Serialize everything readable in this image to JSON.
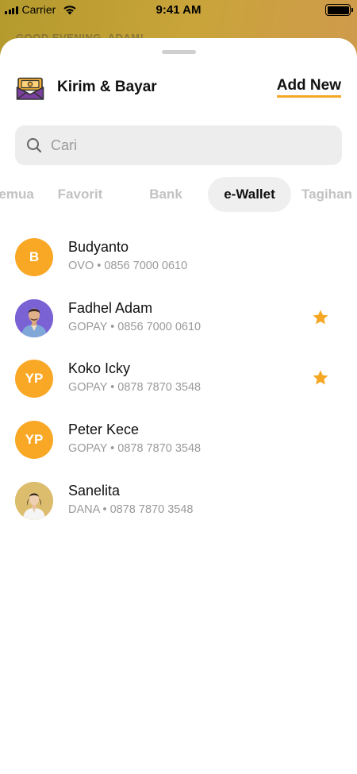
{
  "status_bar": {
    "carrier": "Carrier",
    "time": "9:41 AM"
  },
  "background": {
    "greeting": "GOOD EVENING, ADAM!"
  },
  "header": {
    "title": "Kirim & Bayar",
    "add_new_label": "Add New",
    "icon": "money-envelope-icon"
  },
  "search": {
    "placeholder": "Cari",
    "value": ""
  },
  "tabs": [
    {
      "label": "Semua",
      "active": false
    },
    {
      "label": "Favorit",
      "active": false
    },
    {
      "label": "Bank",
      "active": false
    },
    {
      "label": "e-Wallet",
      "active": true
    },
    {
      "label": "Tagihan",
      "active": false
    }
  ],
  "contacts": [
    {
      "name": "Budyanto",
      "provider": "OVO",
      "phone": "0856 7000 0610",
      "detail": "OVO • 0856 7000 0610",
      "initials": "B",
      "favorite": false
    },
    {
      "name": "Fadhel Adam",
      "provider": "GOPAY",
      "phone": "0856 7000 0610",
      "detail": "GOPAY • 0856 7000 0610",
      "initials": "",
      "favorite": true
    },
    {
      "name": "Koko Icky",
      "provider": "GOPAY",
      "phone": "0878 7870 3548",
      "detail": "GOPAY • 0878 7870 3548",
      "initials": "YP",
      "favorite": true
    },
    {
      "name": "Peter Kece",
      "provider": "GOPAY",
      "phone": "0878 7870 3548",
      "detail": "GOPAY • 0878 7870 3548",
      "initials": "YP",
      "favorite": false
    },
    {
      "name": "Sanelita",
      "provider": "DANA",
      "phone": "0878 7870 3548",
      "detail": "DANA • 0878 7870 3548",
      "initials": "",
      "favorite": false
    }
  ],
  "colors": {
    "accent": "#f9a825",
    "underline": "#f5a623",
    "star": "#f5a623"
  }
}
